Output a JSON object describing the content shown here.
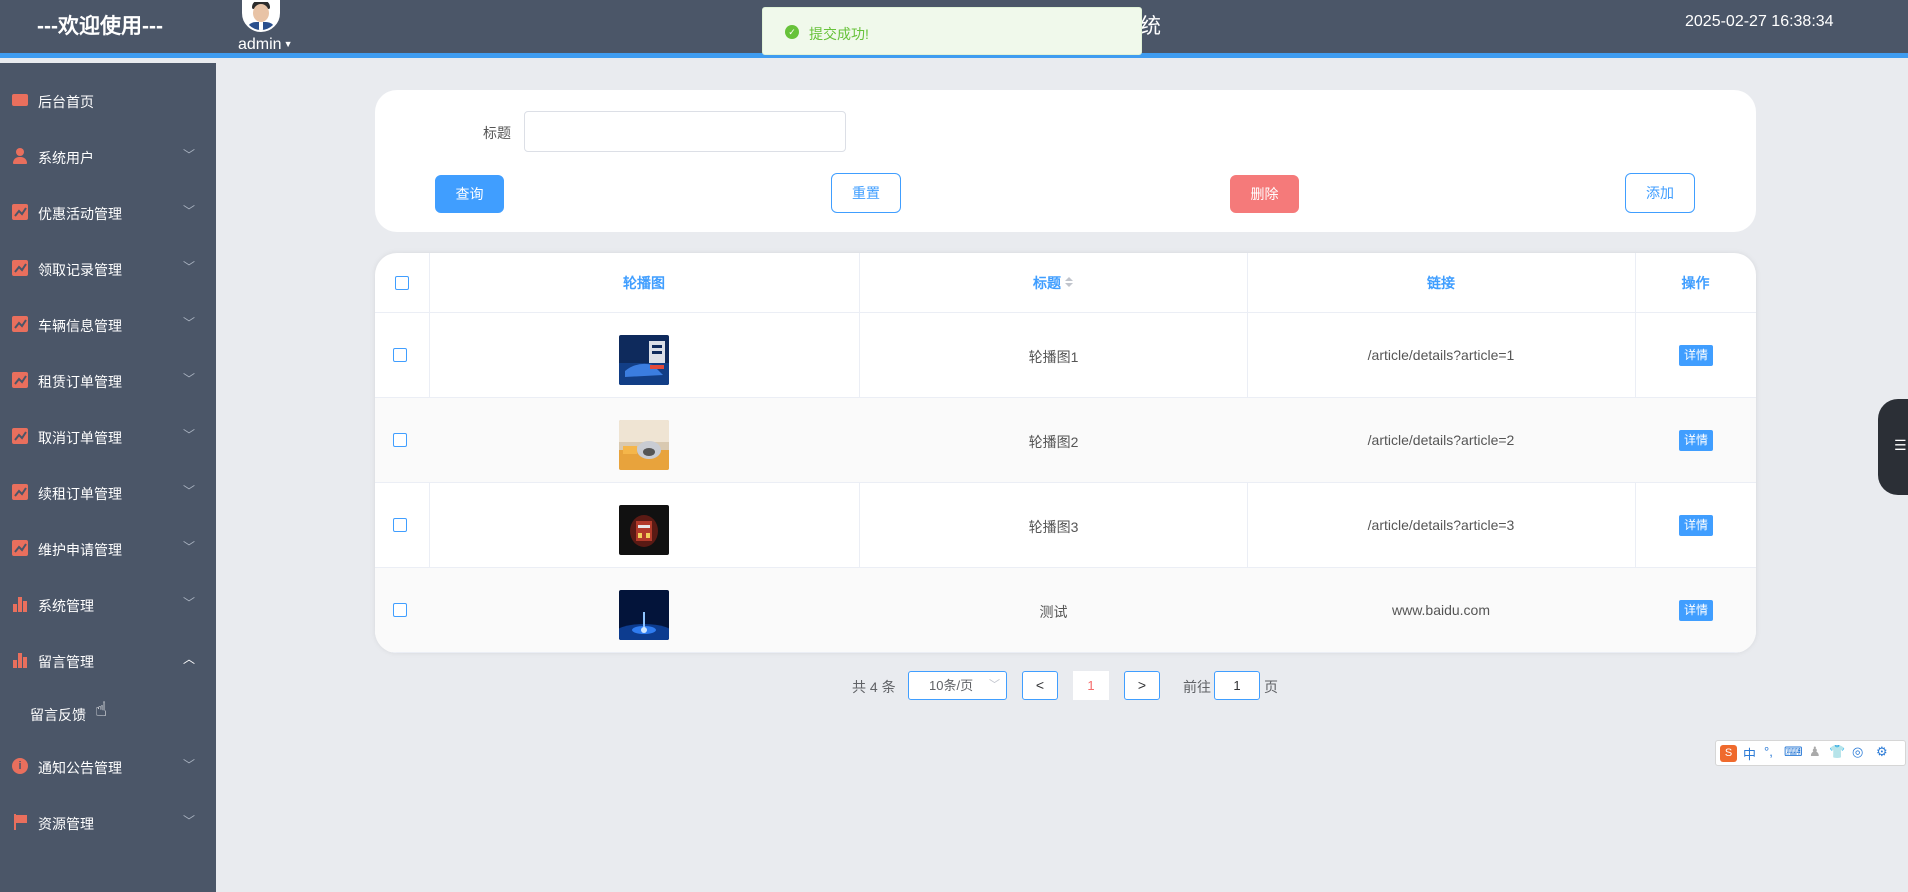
{
  "header": {
    "welcome": "---欢迎使用---",
    "user": "admin",
    "system_title_fragment": "统",
    "datetime": "2025-02-27 16:38:34"
  },
  "toast": {
    "message": "提交成功!"
  },
  "sidebar": {
    "items": [
      {
        "label": "后台首页",
        "icon": "monitor-icon"
      },
      {
        "label": "系统用户",
        "icon": "user-icon"
      },
      {
        "label": "优惠活动管理",
        "icon": "chart-icon"
      },
      {
        "label": "领取记录管理",
        "icon": "chart-icon"
      },
      {
        "label": "车辆信息管理",
        "icon": "chart-icon"
      },
      {
        "label": "租赁订单管理",
        "icon": "chart-icon"
      },
      {
        "label": "取消订单管理",
        "icon": "chart-icon"
      },
      {
        "label": "续租订单管理",
        "icon": "chart-icon"
      },
      {
        "label": "维护申请管理",
        "icon": "chart-icon"
      },
      {
        "label": "系统管理",
        "icon": "bar-chart-icon"
      },
      {
        "label": "留言管理",
        "icon": "bar-chart-icon",
        "expanded": true
      },
      {
        "label": "通知公告管理",
        "icon": "info-icon"
      },
      {
        "label": "资源管理",
        "icon": "flag-icon"
      }
    ],
    "sub_items": [
      {
        "label": "留言反馈"
      }
    ]
  },
  "search": {
    "title_label": "标题",
    "title_value": "",
    "query_label": "查询",
    "reset_label": "重置",
    "delete_label": "删除",
    "add_label": "添加"
  },
  "table": {
    "columns": [
      "轮播图",
      "标题",
      "链接",
      "操作"
    ],
    "rows": [
      {
        "title": "轮播图1",
        "link": "/article/details?article=1",
        "action": "详情"
      },
      {
        "title": "轮播图2",
        "link": "/article/details?article=2",
        "action": "详情"
      },
      {
        "title": "轮播图3",
        "link": "/article/details?article=3",
        "action": "详情"
      },
      {
        "title": "测试",
        "link": "www.baidu.com",
        "action": "详情"
      }
    ]
  },
  "pagination": {
    "total_text": "共 4 条",
    "page_size": "10条/页",
    "current_page": "1",
    "goto_label": "前往",
    "goto_value": "1",
    "page_suffix": "页"
  },
  "ime": {
    "mode": "中"
  },
  "colors": {
    "accent": "#409eff",
    "danger": "#f56c6c",
    "sidebar": "#4b5668",
    "success": "#67c23a"
  }
}
